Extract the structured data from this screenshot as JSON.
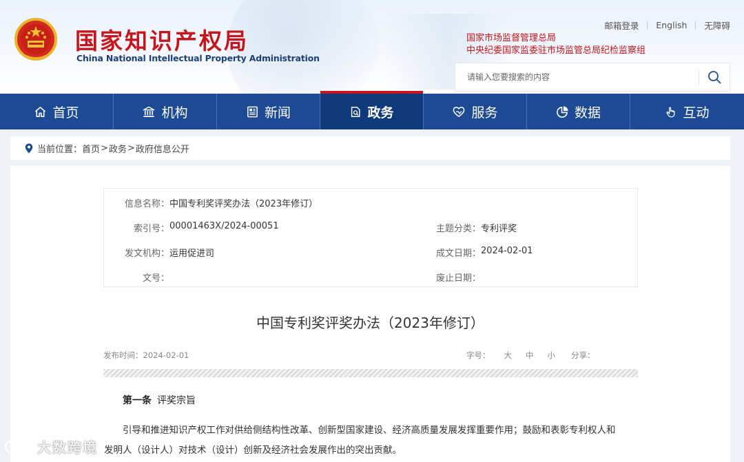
{
  "header": {
    "logo_cn": "国家知识产权局",
    "logo_en": "China National Intellectual Property Administration",
    "top_links": [
      "邮箱登录",
      "English",
      "无障碍"
    ],
    "authority_links": [
      "国家市场监督管理总局",
      "中央纪委国家监委驻市场监管总局纪检监察组"
    ],
    "search": {
      "placeholder": "请输入您要搜索的内容",
      "value": ""
    }
  },
  "nav": {
    "items": [
      {
        "label": "首页",
        "icon": "home-icon"
      },
      {
        "label": "机构",
        "icon": "institution-icon"
      },
      {
        "label": "新闻",
        "icon": "news-icon"
      },
      {
        "label": "政务",
        "icon": "government-affairs-icon",
        "active": true
      },
      {
        "label": "服务",
        "icon": "service-heart-icon"
      },
      {
        "label": "数据",
        "icon": "pie-chart-icon"
      },
      {
        "label": "互动",
        "icon": "hand-pointer-icon"
      }
    ]
  },
  "breadcrumb": {
    "prefix": "当前位置：",
    "items": [
      "首页",
      "政务",
      "政府信息公开"
    ],
    "separator": ">"
  },
  "info": {
    "name_label": "信息名称：",
    "name_value": "中国专利奖评奖办法（2023年修订）",
    "index_label": "索引号：",
    "index_value": "00001463X/2024-00051",
    "topic_label": "主题分类：",
    "topic_value": "专利评奖",
    "issuer_label": "发文机构：",
    "issuer_value": "运用促进司",
    "date_label": "成文日期：",
    "date_value": "2024-02-01",
    "docno_label": "文号：",
    "docno_value": "",
    "expire_label": "废止日期：",
    "expire_value": ""
  },
  "article": {
    "title": "中国专利奖评奖办法（2023年修订）",
    "publish_label": "发布时间：",
    "publish_date": "2024-02-01",
    "font_label": "字号：",
    "font_sizes": [
      "大",
      "中",
      "小"
    ],
    "share_label": "分享：",
    "section_no": "第一条",
    "section_title": "评奖宗旨",
    "para_line1": "引导和推进知识产权工作对供给侧结构性改革、创新型国家建设、经济高质量发展发挥重要作用；鼓励和表彰专利权人和",
    "para_line2": "发明人（设计人）对技术（设计）创新及经济社会发展作出的突出贡献。"
  },
  "watermark": {
    "text": "大数跨境"
  },
  "colors": {
    "brand_red": "#c4161c",
    "nav_blue": "#1c4a94",
    "nav_active": "#0f3a7c",
    "logo_en_blue": "#1e3f78"
  }
}
